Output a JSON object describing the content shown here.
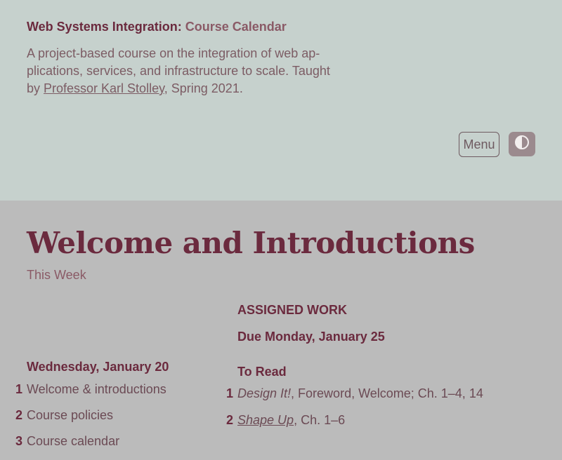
{
  "header": {
    "course_title": "Web Systems Integration:",
    "course_subtitle": "Course Calendar",
    "desc_before": "A project-based course on the integration of web ap- plications, services, and infrastructure to scale. Taught by ",
    "professor_link": "Professor Karl Stolley",
    "desc_after": ", Spring 2021.",
    "menu_label": "Menu",
    "theme_icon": "contrast-icon"
  },
  "main": {
    "title": "Welcome and Introductions",
    "this_week": "This Week",
    "day_heading": "Wednesday, January 20",
    "day_items": [
      {
        "num": "1",
        "label": "Welcome & introductions"
      },
      {
        "num": "2",
        "label": "Course policies"
      },
      {
        "num": "3",
        "label": "Course calendar"
      }
    ],
    "assigned_work": "ASSIGNED WORK",
    "due": "Due Monday, January 25",
    "to_read": "To Read",
    "readings": [
      {
        "num": "1",
        "title": "Design It!",
        "rest": ", Foreword, Welcome; Ch. 1–4, 14"
      },
      {
        "num": "2",
        "title": "Shape Up",
        "rest": ", Ch. 1–6"
      }
    ]
  },
  "colors": {
    "header_bg": "#c6d1cd",
    "body_bg": "#bbbbbb",
    "accent": "#6b2a3e"
  }
}
